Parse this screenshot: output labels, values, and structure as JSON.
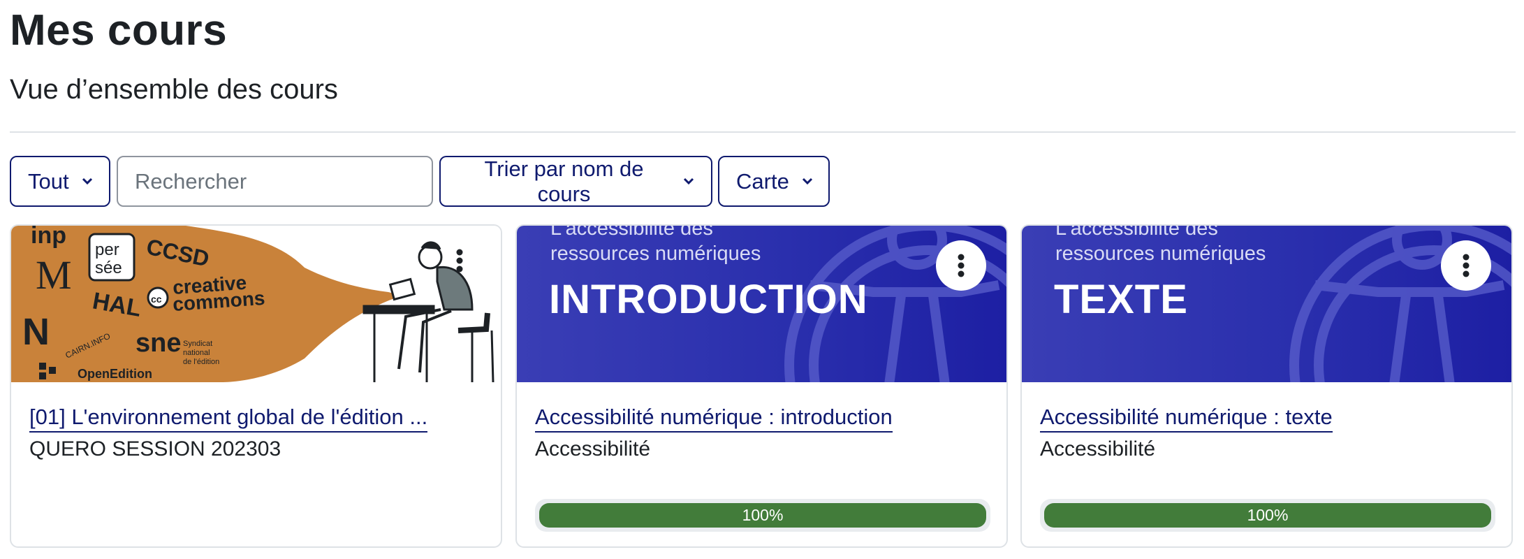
{
  "page": {
    "title": "Mes cours",
    "subtitle": "Vue d’ensemble des cours"
  },
  "filters": {
    "grouping_label": "Tout",
    "search_placeholder": "Rechercher",
    "sort_label": "Trier par nom de cours",
    "view_label": "Carte"
  },
  "colors": {
    "accent": "#0f1a6e",
    "banner": "#2a2fad",
    "progress": "#427c3a",
    "illustration_orange": "#c9823a"
  },
  "courses": [
    {
      "title": "[01] L'environnement global de l'édition ...",
      "category": "QUERO SESSION 202303",
      "image_text": [
        "per",
        "sée",
        "CCSD",
        "HAL",
        "creative",
        "commons",
        "Syndicat",
        "national",
        "de l'édition",
        "CAIRN.INFO",
        "OpenEdition"
      ],
      "menu_icon": "vertical-dots-icon"
    },
    {
      "title": "Accessibilité numérique : introduction",
      "category": "Accessibilité",
      "banner_small": "L'accessibilité des\nressources numériques",
      "banner_big": "INTRODUCTION",
      "progress": 100,
      "progress_label": "100%",
      "menu_icon": "vertical-dots-icon"
    },
    {
      "title": "Accessibilité numérique : texte",
      "category": "Accessibilité",
      "banner_small": "L'accessibilité des\nressources numériques",
      "banner_big": "TEXTE",
      "progress": 100,
      "progress_label": "100%",
      "menu_icon": "vertical-dots-icon"
    }
  ]
}
